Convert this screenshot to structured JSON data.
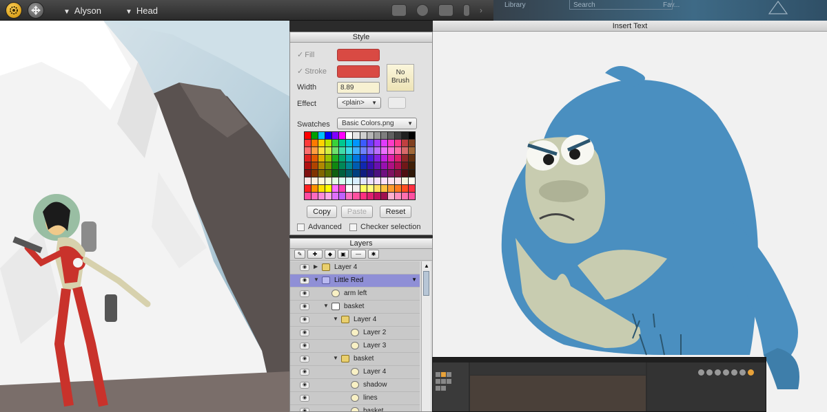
{
  "topbar": {
    "menu_character": "Alyson",
    "menu_part": "Head",
    "strip_library": "Library",
    "strip_search": "Search",
    "strip_fav": "Fav..."
  },
  "insert_window": {
    "title": "Insert Text"
  },
  "style_panel": {
    "title": "Style",
    "fill_label": "Fill",
    "stroke_label": "Stroke",
    "width_label": "Width",
    "width_value": "8.89",
    "effect_label": "Effect",
    "effect_value": "<plain>",
    "no_brush": "No Brush",
    "swatches_label": "Swatches",
    "swatches_value": "Basic Colors.png",
    "copy": "Copy",
    "paste": "Paste",
    "reset": "Reset",
    "advanced": "Advanced",
    "checker": "Checker selection",
    "fill_color": "#d94a43",
    "stroke_color": "#d94a43"
  },
  "layers_panel": {
    "title": "Layers",
    "rows": [
      {
        "label": "Layer 4",
        "indent": 0,
        "icon": "folder",
        "twisty": "▶"
      },
      {
        "label": "Little Red",
        "indent": 0,
        "icon": "char",
        "twisty": "▼",
        "selected": true
      },
      {
        "label": "arm left",
        "indent": 1,
        "icon": "shape",
        "twisty": ""
      },
      {
        "label": "basket",
        "indent": 1,
        "icon": "group",
        "twisty": "▼"
      },
      {
        "label": "Layer 4",
        "indent": 2,
        "icon": "folder",
        "twisty": "▼"
      },
      {
        "label": "Layer 2",
        "indent": 3,
        "icon": "shape",
        "twisty": ""
      },
      {
        "label": "Layer 3",
        "indent": 3,
        "icon": "shape",
        "twisty": ""
      },
      {
        "label": "basket",
        "indent": 2,
        "icon": "folder",
        "twisty": "▼"
      },
      {
        "label": "Layer 4",
        "indent": 3,
        "icon": "shape",
        "twisty": ""
      },
      {
        "label": "shadow",
        "indent": 3,
        "icon": "shape",
        "twisty": ""
      },
      {
        "label": "lines",
        "indent": 3,
        "icon": "shape",
        "twisty": ""
      },
      {
        "label": "basket",
        "indent": 3,
        "icon": "shape",
        "twisty": ""
      }
    ]
  },
  "swatch_colors": [
    "#ff0000",
    "#00a000",
    "#00c0ff",
    "#0000ff",
    "#8000ff",
    "#ff00ff",
    "#ffffff",
    "#e6e6e6",
    "#cfcfcf",
    "#b5b5b5",
    "#9a9a9a",
    "#7e7e7e",
    "#5f5f5f",
    "#3f3f3f",
    "#202020",
    "#000000",
    "#ff3b3b",
    "#ff7a00",
    "#ffd200",
    "#bfe600",
    "#3ad13a",
    "#00c890",
    "#00c8d8",
    "#0096ff",
    "#3b5bff",
    "#6a3bff",
    "#a23bff",
    "#e03bff",
    "#ff3bc8",
    "#ff3b8a",
    "#c04040",
    "#804020",
    "#ff6e6e",
    "#ff9e40",
    "#ffe040",
    "#d4f040",
    "#6ee06e",
    "#40dca8",
    "#40dce6",
    "#40b0ff",
    "#6e82ff",
    "#936eff",
    "#bb6eff",
    "#ec6eff",
    "#ff6ed8",
    "#ff6ea6",
    "#d86a6a",
    "#a06838",
    "#e02020",
    "#e05a00",
    "#e0b000",
    "#9cc400",
    "#20b020",
    "#00a870",
    "#00a8b8",
    "#0078e0",
    "#203ce0",
    "#4c20e0",
    "#8420e0",
    "#c020e0",
    "#e020a8",
    "#e0206c",
    "#902828",
    "#603010",
    "#b01010",
    "#b04400",
    "#b08800",
    "#789800",
    "#108810",
    "#008858",
    "#008894",
    "#005cb0",
    "#1028b0",
    "#3810b0",
    "#6810b0",
    "#9810b0",
    "#b01084",
    "#b01054",
    "#701818",
    "#402008",
    "#801010",
    "#803300",
    "#806600",
    "#587000",
    "#106010",
    "#006040",
    "#00606a",
    "#004080",
    "#101c80",
    "#281080",
    "#4c1080",
    "#701080",
    "#801060",
    "#80103c",
    "#501010",
    "#301808",
    "#ffe4e4",
    "#ffeedd",
    "#fff8d8",
    "#f4ffd8",
    "#e4ffe4",
    "#d8fff0",
    "#d8fcff",
    "#d8efff",
    "#e0e6ff",
    "#ebe0ff",
    "#f4e0ff",
    "#ffe0fc",
    "#ffe0f0",
    "#ffe0e8",
    "#f5f5dc",
    "#fffff0",
    "#ff2020",
    "#ff9000",
    "#ffe000",
    "#ffff00",
    "#ff70ff",
    "#ff40b0",
    "#ffffff",
    "#f0f0f0",
    "#ffff60",
    "#ffff80",
    "#ffe060",
    "#ffc040",
    "#ff9a30",
    "#ff7a20",
    "#ff5020",
    "#ff3040",
    "#ff4aa0",
    "#ff6ac0",
    "#ff8ad8",
    "#ffaae6",
    "#e070ff",
    "#c060ff",
    "#ff70c0",
    "#ff50a0",
    "#ff3080",
    "#e02070",
    "#c01060",
    "#a01050",
    "#ffb0d0",
    "#ff90c0",
    "#ff70b0",
    "#ff50a0"
  ]
}
